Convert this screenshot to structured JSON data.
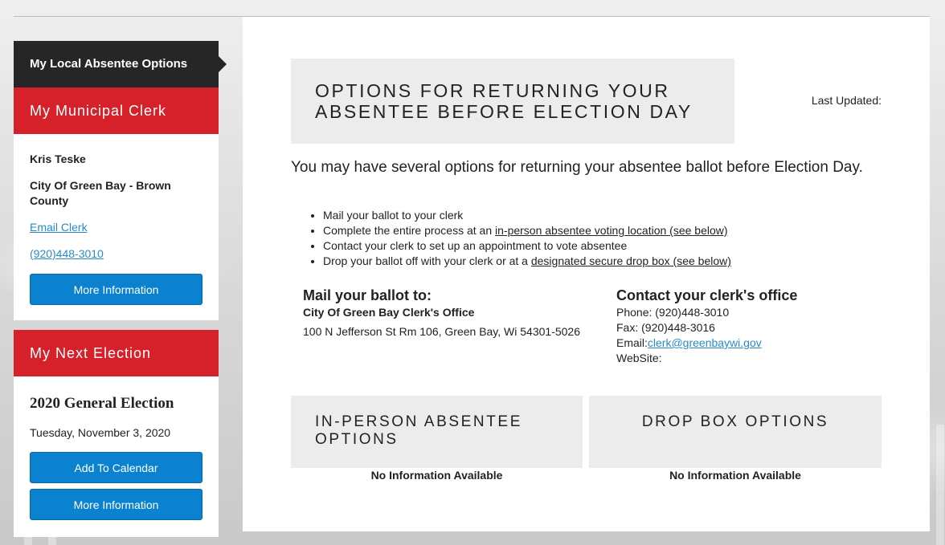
{
  "sidebar": {
    "local_tab_label": "My Local Absentee Options",
    "clerk_header": "My Municipal Clerk",
    "clerk": {
      "name": "Kris Teske",
      "municipality": "City Of Green Bay - Brown County",
      "email_link": "Email Clerk",
      "phone_link": "(920)448-3010",
      "more_info_label": "More Information"
    },
    "election_header": "My Next Election",
    "election": {
      "name": "2020 General Election",
      "date": "Tuesday, November 3, 2020",
      "add_calendar_label": "Add To Calendar",
      "more_info_label": "More Information"
    }
  },
  "main": {
    "title": "OPTIONS FOR RETURNING YOUR ABSENTEE BEFORE ELECTION DAY",
    "last_updated_label": "Last Updated:",
    "intro": "You may have several options for returning your absentee ballot before Election Day.",
    "options": [
      {
        "text": "Mail your ballot to your clerk",
        "link": "",
        "suffix": ""
      },
      {
        "text": "Complete the entire process at an ",
        "link": "in-person absentee voting location (see below)",
        "suffix": ""
      },
      {
        "text": "Contact your clerk to set up an appointment to vote absentee",
        "link": "",
        "suffix": ""
      },
      {
        "text": "Drop your ballot off with your clerk or at a ",
        "link": "designated secure drop box",
        "suffix": " (see below)"
      }
    ],
    "mail": {
      "heading": "Mail your ballot to:",
      "office": "City Of Green Bay Clerk's Office",
      "address": "100 N Jefferson St Rm 106, Green Bay, Wi 54301-5026"
    },
    "contact": {
      "heading": "Contact your clerk's office",
      "phone": "Phone: (920)448-3010",
      "fax": "Fax: (920)448-3016",
      "email_label": "Email:",
      "email": "clerk@greenbaywi.gov",
      "website_label": "WebSite:"
    },
    "inperson": {
      "heading": "IN-PERSON ABSENTEE OPTIONS",
      "status": "No Information Available"
    },
    "dropbox": {
      "heading": "DROP BOX OPTIONS",
      "status": "No Information Available"
    }
  },
  "colors": {
    "dark_tab": "#262626",
    "red_header": "#d6202a",
    "button_blue": "#0a82d0",
    "link_blue": "#2a8ac9",
    "panel_gray": "#ececec"
  }
}
